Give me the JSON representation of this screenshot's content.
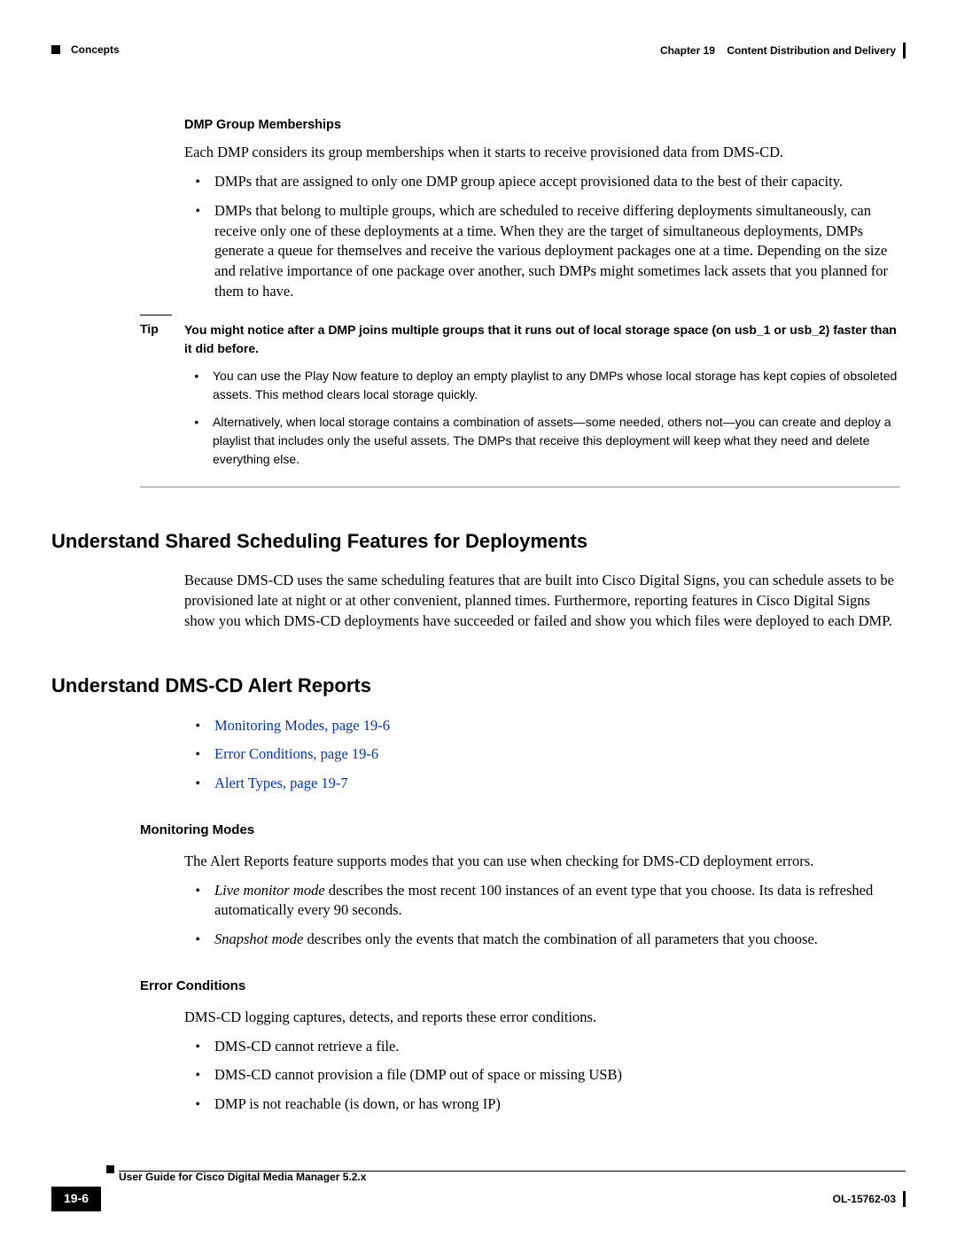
{
  "header": {
    "left": "Concepts",
    "chapter": "Chapter 19",
    "title": "Content Distribution and Delivery"
  },
  "dmp": {
    "heading": "DMP Group Memberships",
    "intro": "Each DMP considers its group memberships when it starts to receive provisioned data from DMS-CD.",
    "b1": "DMPs that are assigned to only one DMP group apiece accept provisioned data to the best of their capacity.",
    "b2": "DMPs that belong to multiple groups, which are scheduled to receive differing deployments simultaneously, can receive only one of these deployments at a time. When they are the target of simultaneous deployments, DMPs generate a queue for themselves and receive the various deployment packages one at a time. Depending on the size and relative importance of one package over another, such DMPs might sometimes lack assets that you planned for them to have."
  },
  "tip": {
    "label": "Tip",
    "lead": "You might notice after a DMP joins multiple groups that it runs out of local storage space (on usb_1 or usb_2) faster than it did before.",
    "b1": "You can use the Play Now feature to deploy an empty playlist to any DMPs whose local storage has kept copies of obsoleted assets. This method clears local storage quickly.",
    "b2": "Alternatively, when local storage contains a combination of assets—some needed, others not—you can create and deploy a playlist that includes only the useful assets. The DMPs that receive this deployment will keep what they need and delete everything else."
  },
  "sched": {
    "heading": "Understand Shared Scheduling Features for Deployments",
    "para": "Because DMS-CD uses the same scheduling features that are built into Cisco Digital Signs, you can schedule assets to be provisioned late at night or at other convenient, planned times. Furthermore, reporting features in Cisco Digital Signs show you which DMS-CD deployments have succeeded or failed and show you which files were deployed to each DMP."
  },
  "alerts": {
    "heading": "Understand DMS-CD Alert Reports",
    "link1": "Monitoring Modes, page 19-6",
    "link2": "Error Conditions, page 19-6",
    "link3": "Alert Types, page 19-7"
  },
  "modes": {
    "heading": "Monitoring Modes",
    "intro": "The Alert Reports feature supports modes that you can use when checking for DMS-CD deployment errors.",
    "b1_em": "Live monitor mode",
    "b1_rest": " describes the most recent 100 instances of an event type that you choose. Its data is refreshed automatically every 90 seconds.",
    "b2_em": "Snapshot mode",
    "b2_rest": " describes only the events that match the combination of all parameters that you choose."
  },
  "errors": {
    "heading": "Error Conditions",
    "intro": "DMS-CD logging captures, detects, and reports these error conditions.",
    "b1": "DMS-CD cannot retrieve a file.",
    "b2": "DMS-CD cannot provision a file (DMP out of space or missing USB)",
    "b3": "DMP is not reachable (is down, or has wrong IP)"
  },
  "footer": {
    "guide": "User Guide for Cisco Digital Media Manager 5.2.x",
    "page": "19-6",
    "doc": "OL-15762-03"
  }
}
